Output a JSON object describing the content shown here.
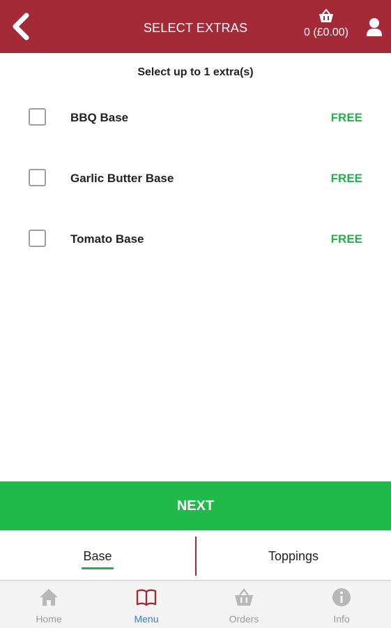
{
  "header": {
    "title": "SELECT EXTRAS",
    "basket_label": "0 (£0.00)",
    "back_icon": "chevron-left-icon",
    "basket_icon": "basket-icon",
    "account_icon": "person-icon",
    "background_color": "#a42a37"
  },
  "subtitle": "Select up to 1 extra(s)",
  "extras": [
    {
      "name": "BBQ Base",
      "price": "FREE",
      "checked": false
    },
    {
      "name": "Garlic Butter Base",
      "price": "FREE",
      "checked": false
    },
    {
      "name": "Tomato Base",
      "price": "FREE",
      "checked": false
    }
  ],
  "next_button": {
    "label": "NEXT",
    "color": "#1fba4a"
  },
  "step_tabs": [
    {
      "label": "Base",
      "active": true
    },
    {
      "label": "Toppings",
      "active": false
    }
  ],
  "bottom_nav": [
    {
      "label": "Home",
      "icon": "home-icon",
      "active": false
    },
    {
      "label": "Menu",
      "icon": "book-icon",
      "active": true
    },
    {
      "label": "Orders",
      "icon": "basket-icon",
      "active": false
    },
    {
      "label": "Info",
      "icon": "info-icon",
      "active": false
    }
  ],
  "colors": {
    "price_green": "#22b14c",
    "active_nav": "#2f80d8",
    "inactive_nav": "#9a9a9a"
  }
}
